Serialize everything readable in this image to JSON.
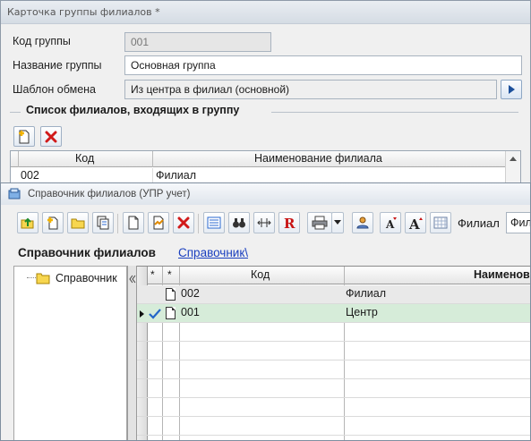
{
  "card_window": {
    "title": "Карточка группы филиалов *",
    "fields": {
      "code_label": "Код группы",
      "code_value": "001",
      "name_label": "Название группы",
      "name_value": "Основная группа",
      "template_label": "Шаблон обмена",
      "template_value": "Из центра в филиал (основной)"
    },
    "group_title": "Список филиалов, входящих в группу",
    "toolbar": {
      "add_icon": "add-document-icon",
      "delete_icon": "red-x-delete-icon"
    },
    "grid": {
      "columns": [
        "Код",
        "Наименование филиала"
      ],
      "rows": [
        {
          "code": "002",
          "name": "Филиал"
        }
      ]
    }
  },
  "dir_window": {
    "title": "Справочник филиалов (УПР учет)",
    "toolbar_filter_label": "Филиал",
    "toolbar_filter_value": "Фил",
    "heading": "Справочник филиалов",
    "breadcrumb_link": "Справочник\\",
    "tree": [
      {
        "label": "Справочник",
        "icon": "folder-icon"
      }
    ],
    "grid": {
      "columns": [
        "*",
        "*",
        "Код",
        "Наименов"
      ],
      "rows": [
        {
          "code": "002",
          "name": "Филиал",
          "selected": false,
          "checked": false
        },
        {
          "code": "001",
          "name": "Центр",
          "selected": true,
          "checked": true
        }
      ]
    }
  },
  "colors": {
    "selected_row": "#d6ecd9",
    "link": "#1a3fbf",
    "delete_red": "#d11a1a",
    "combo_arrow": "#1b4f9b"
  }
}
